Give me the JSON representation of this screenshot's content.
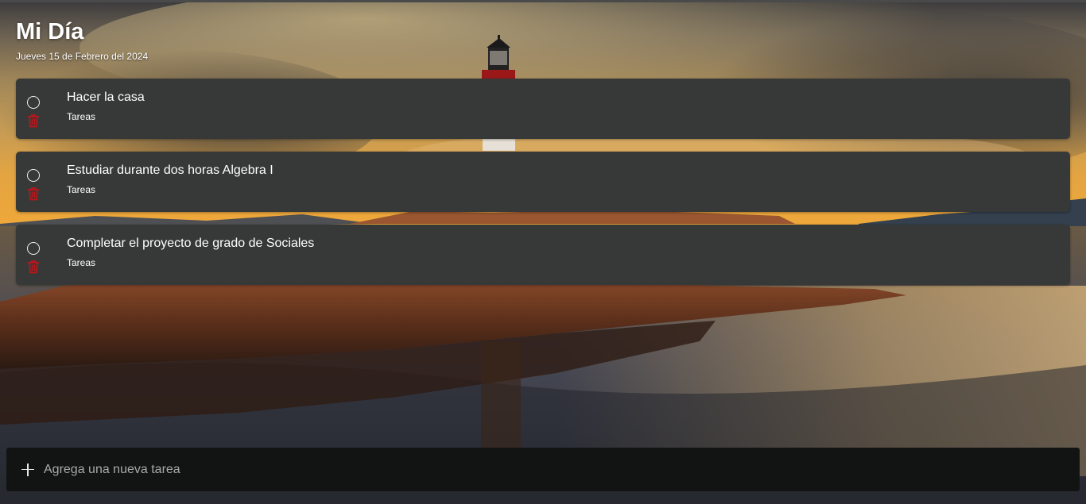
{
  "header": {
    "title": "Mi Día",
    "date": "Jueves 15 de Febrero del 2024"
  },
  "tasks": [
    {
      "title": "Hacer la casa",
      "category": "Tareas",
      "completed": false
    },
    {
      "title": "Estudiar durante dos horas Algebra I",
      "category": "Tareas",
      "completed": false
    },
    {
      "title": "Completar el proyecto de grado de Sociales",
      "category": "Tareas",
      "completed": false
    }
  ],
  "new_task": {
    "placeholder": "Agrega una nueva tarea",
    "value": ""
  },
  "icons": {
    "complete": "circle-icon",
    "delete": "trash-icon",
    "add": "plus-icon"
  },
  "colors": {
    "card_background": "#373838",
    "delete_icon": "#c0141a",
    "new_task_bar": "#121414"
  }
}
